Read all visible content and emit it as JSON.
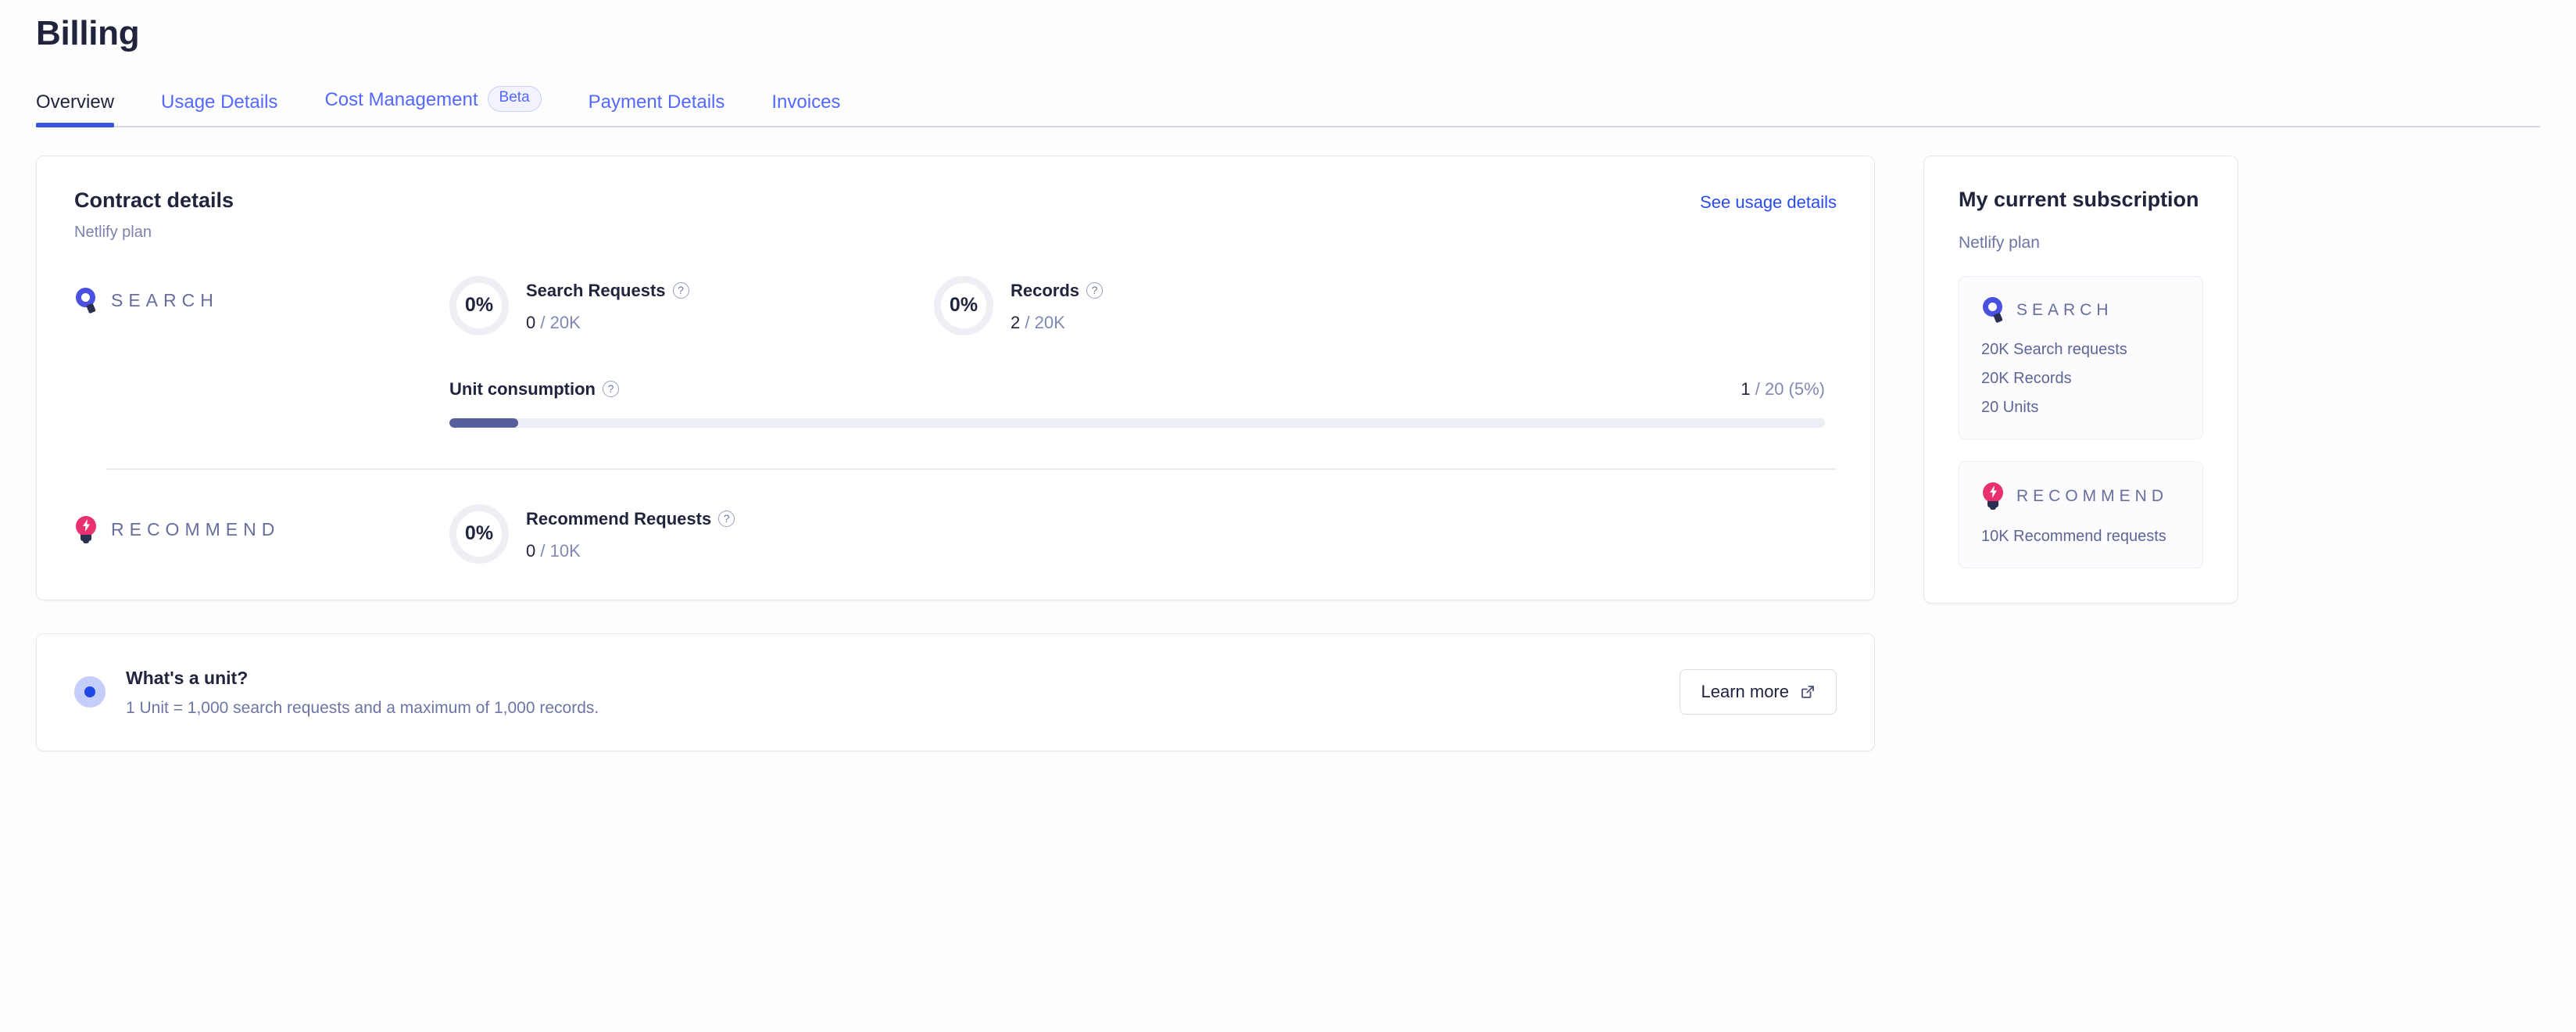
{
  "page": {
    "title": "Billing"
  },
  "tabs": [
    {
      "label": "Overview",
      "active": true,
      "badge": null
    },
    {
      "label": "Usage Details",
      "active": false,
      "badge": null
    },
    {
      "label": "Cost Management",
      "active": false,
      "badge": "Beta"
    },
    {
      "label": "Payment Details",
      "active": false,
      "badge": null
    },
    {
      "label": "Invoices",
      "active": false,
      "badge": null
    }
  ],
  "contract": {
    "title": "Contract details",
    "plan": "Netlify plan",
    "usage_link": "See usage details",
    "search": {
      "product_name": "SEARCH",
      "icon": "algolia-search-icon",
      "metrics": [
        {
          "percent": "0%",
          "name": "Search Requests",
          "help_icon": "question-circle-icon",
          "used": "0",
          "limit": "/ 20K"
        },
        {
          "percent": "0%",
          "name": "Records",
          "help_icon": "question-circle-icon",
          "used": "2",
          "limit": "/ 20K"
        }
      ],
      "unit_consumption": {
        "label": "Unit consumption",
        "help_icon": "question-circle-icon",
        "used": "1",
        "detail": "/ 20 (5%)",
        "percent": 5
      }
    },
    "recommend": {
      "product_name": "RECOMMEND",
      "icon": "recommend-bulb-icon",
      "metrics": [
        {
          "percent": "0%",
          "name": "Recommend Requests",
          "help_icon": "question-circle-icon",
          "used": "0",
          "limit": "/ 10K"
        }
      ]
    }
  },
  "unit_info": {
    "icon": "info-dot-icon",
    "heading": "What's a unit?",
    "description": "1 Unit = 1,000 search requests and a maximum of 1,000 records.",
    "button_label": "Learn more",
    "button_icon": "external-link-icon"
  },
  "subscription": {
    "title": "My current subscription",
    "plan": "Netlify plan",
    "blocks": [
      {
        "name": "SEARCH",
        "icon": "algolia-search-icon",
        "features": [
          "20K Search requests",
          "20K Records",
          "20 Units"
        ]
      },
      {
        "name": "RECOMMEND",
        "icon": "recommend-bulb-icon",
        "features": [
          "10K Recommend requests"
        ]
      }
    ]
  },
  "colors": {
    "accent_blue": "#5468ff",
    "link_blue": "#2b4bf2",
    "tab_underline": "#3c4fe0",
    "search_icon": "#4a50e0",
    "recommend_icon": "#e8316d",
    "progress_fill": "#575e9e",
    "text_dark": "#21243d",
    "text_muted": "#7c83a8"
  }
}
